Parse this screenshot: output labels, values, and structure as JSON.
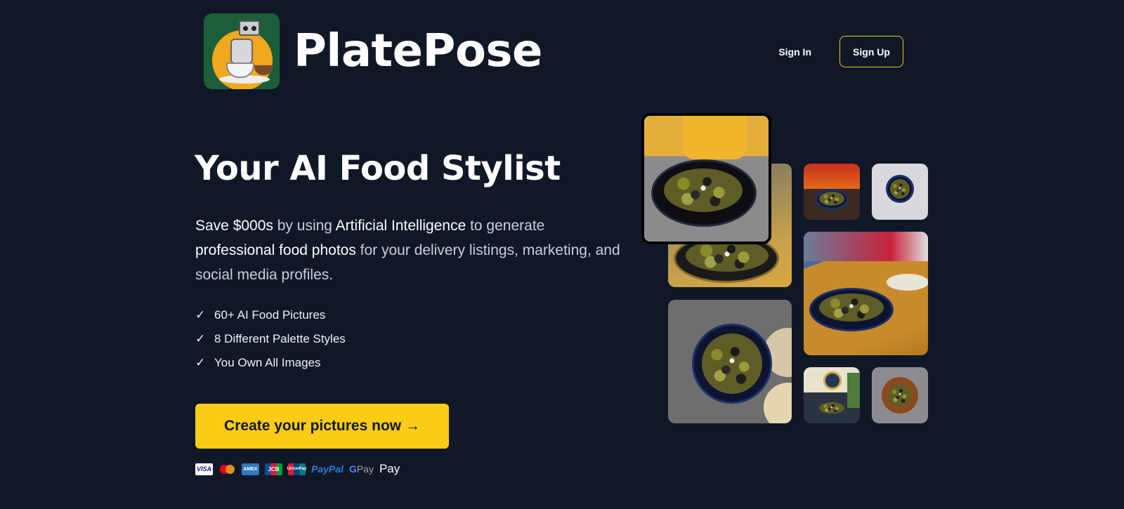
{
  "header": {
    "brand": "PlatePose",
    "nav": {
      "sign_in": "Sign In",
      "sign_up": "Sign Up"
    }
  },
  "hero": {
    "title": "Your AI Food Stylist",
    "description": {
      "p1_bold": "Save $000s",
      "p2": " by using ",
      "p3_bold": "Artificial Intelligence",
      "p4": " to generate ",
      "p5_bold": "professional food photos",
      "p6": " for your delivery listings, marketing, and social media profiles."
    },
    "features": [
      {
        "check": "✓",
        "label": "60+ AI Food Pictures"
      },
      {
        "check": "✓",
        "label": "8 Different Palette Styles"
      },
      {
        "check": "✓",
        "label": "You Own All Images"
      }
    ],
    "cta_label": "Create your pictures now →"
  },
  "payments": {
    "visa": "VISA",
    "amex": "AMEX",
    "jcb": "JCB",
    "unionpay": "UnionPay",
    "paypal": "PayPal",
    "gpay": "Pay",
    "gpay_g": "G",
    "applepay": "Pay",
    "apple_glyph": ""
  },
  "icons": {
    "logo": "robot-chef-logo-icon",
    "check": "checkmark-icon"
  },
  "colors": {
    "background": "#101828",
    "accent": "#facc15",
    "signup_border": "#f5c518"
  }
}
